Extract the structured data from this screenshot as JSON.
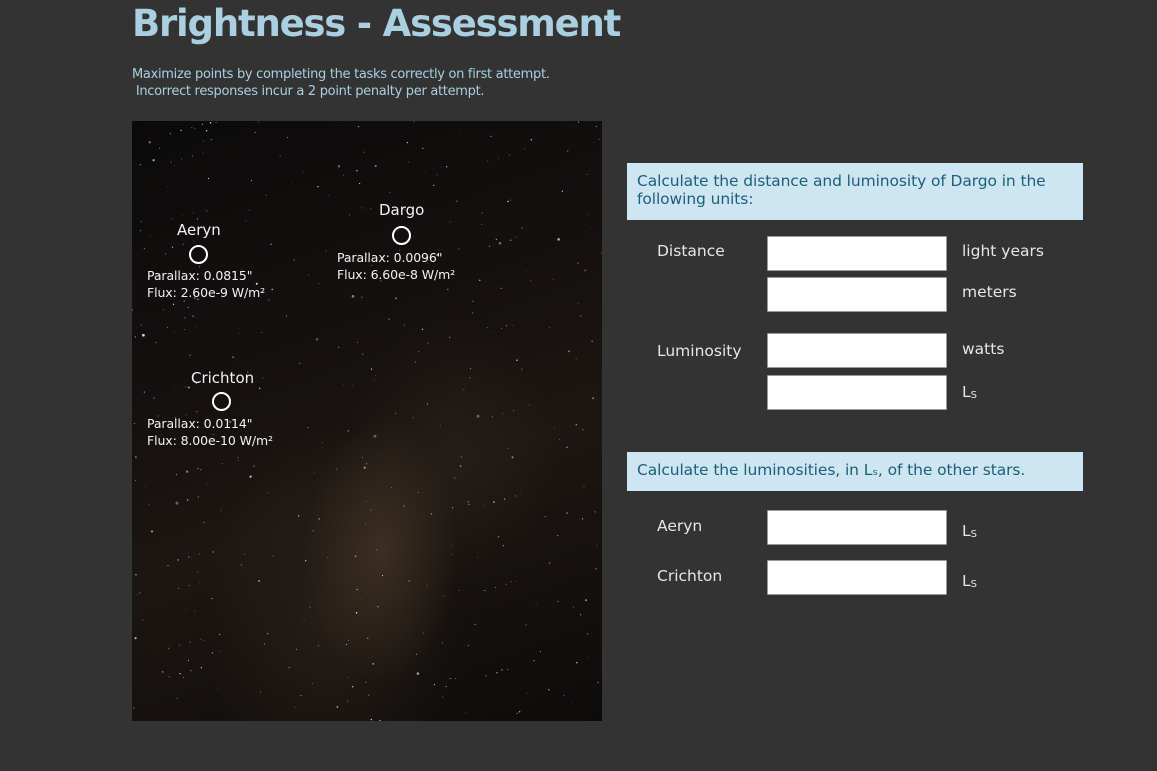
{
  "title": "Brightness - Assessment",
  "instructions": {
    "line1": "Maximize points by completing the tasks correctly on first attempt.",
    "line2": " Incorrect responses incur a 2 point penalty per attempt."
  },
  "stars": [
    {
      "name": "Aeryn",
      "parallax": "Parallax:  0.0815\"",
      "flux": "Flux:  2.60e-9 W/m²"
    },
    {
      "name": "Dargo",
      "parallax": "Parallax:  0.0096\"",
      "flux": "Flux:  6.60e-8 W/m²"
    },
    {
      "name": "Crichton",
      "parallax": "Parallax:  0.0114\"",
      "flux": "Flux:  8.00e-10 W/m²"
    }
  ],
  "task1": {
    "prompt": "Calculate the distance and luminosity of Dargo in the following units:",
    "distance_label": "Distance",
    "luminosity_label": "Luminosity",
    "units": {
      "light_years": "light years",
      "meters": "meters",
      "watts": "watts",
      "solar_L": "L",
      "solar_sub": "S"
    },
    "inputs": {
      "distance_ly": "",
      "distance_m": "",
      "luminosity_w": "",
      "luminosity_ls": ""
    }
  },
  "task2": {
    "prompt": "Calculate the luminosities, in Lₛ, of the other stars.",
    "aeryn_label": "Aeryn",
    "crichton_label": "Crichton",
    "inputs": {
      "aeryn": "",
      "crichton": ""
    }
  },
  "colors": {
    "background": "#333333",
    "title": "#a9cfe1",
    "banner_bg": "#cde6f1",
    "banner_text": "#1d5f78"
  }
}
